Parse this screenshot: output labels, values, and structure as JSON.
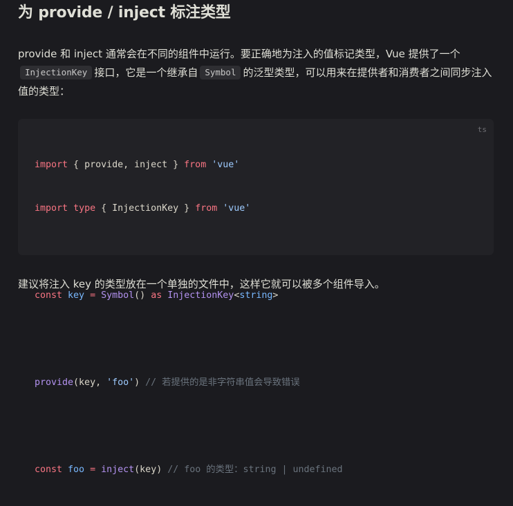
{
  "heading": "为 provide / inject 标注类型",
  "para1": {
    "part1": "provide 和 inject 通常会在不同的组件中运行。要正确地为注入的值标记类型，Vue 提供了一个",
    "code1": "InjectionKey",
    "part2": "接口，它是一个继承自",
    "code2": "Symbol",
    "part3": "的泛型类型，可以用来在提供者和消费者之间同步注入值的类型："
  },
  "code_block": {
    "lang": "ts",
    "line1": {
      "kw_import": "import",
      "p1": " { provide, inject } ",
      "kw_from": "from",
      "sp": " ",
      "str": "'vue'"
    },
    "line2": {
      "kw_import": "import",
      "sp1": " ",
      "kw_type": "type",
      "p1": " { InjectionKey } ",
      "kw_from": "from",
      "sp2": " ",
      "str": "'vue'"
    },
    "line3": {
      "kw_const": "const",
      "sp1": " ",
      "var": "key",
      "sp2": " ",
      "eq": "=",
      "sp3": " ",
      "fn": "Symbol",
      "paren": "()",
      "sp4": " ",
      "kw_as": "as",
      "sp5": " ",
      "type": "InjectionKey",
      "lt": "<",
      "type_arg": "string",
      "gt": ">"
    },
    "line4": {
      "fn": "provide",
      "p1": "(key, ",
      "str": "'foo'",
      "p2": ")",
      "sp": " ",
      "comment": "// 若提供的是非字符串值会导致错误"
    },
    "line5": {
      "kw_const": "const",
      "sp1": " ",
      "var": "foo",
      "sp2": " ",
      "eq": "=",
      "sp3": " ",
      "fn": "inject",
      "p1": "(key)",
      "sp4": " ",
      "comment": "// foo 的类型：string | undefined"
    }
  },
  "para2": "建议将注入 key 的类型放在一个单独的文件中，这样它就可以被多个组件导入。"
}
